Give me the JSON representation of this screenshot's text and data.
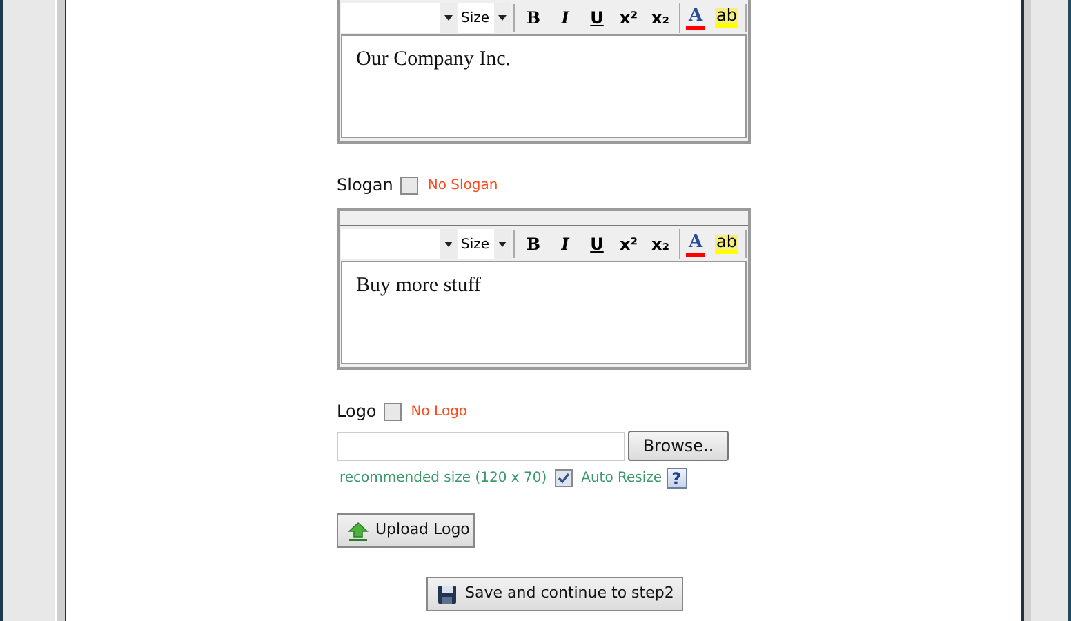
{
  "editors": [
    {
      "toolbar": {
        "size_label": "Size",
        "tools": [
          {
            "kind": "bold",
            "glyph": "B"
          },
          {
            "kind": "italic",
            "glyph": "I"
          },
          {
            "kind": "underline",
            "glyph": "U"
          },
          {
            "kind": "superscript",
            "glyph": "x²"
          },
          {
            "kind": "subscript",
            "glyph": "x₂"
          },
          {
            "kind": "font-color",
            "glyph": "A"
          },
          {
            "kind": "highlight",
            "glyph": "ab"
          }
        ]
      },
      "content": "Our Company Inc."
    },
    {
      "label": {
        "text": "Slogan",
        "checked": false,
        "option": "No Slogan"
      },
      "toolbar": {
        "size_label": "Size",
        "tools": [
          {
            "kind": "bold",
            "glyph": "B"
          },
          {
            "kind": "italic",
            "glyph": "I"
          },
          {
            "kind": "underline",
            "glyph": "U"
          },
          {
            "kind": "superscript",
            "glyph": "x²"
          },
          {
            "kind": "subscript",
            "glyph": "x₂"
          },
          {
            "kind": "font-color",
            "glyph": "A"
          },
          {
            "kind": "highlight",
            "glyph": "ab"
          }
        ]
      },
      "content": "Buy more stuff"
    }
  ],
  "logo": {
    "label": "Logo",
    "checked": false,
    "option": "No Logo",
    "browse_button": "Browse..",
    "hint": "recommended size (120 x 70)",
    "auto_resize": {
      "label": "Auto Resize",
      "checked": true
    },
    "help": "?",
    "upload_button": "Upload Logo"
  },
  "save_button": "Save and continue to step2"
}
